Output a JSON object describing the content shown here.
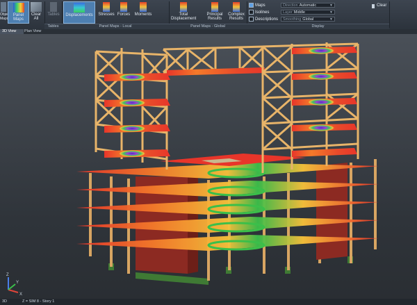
{
  "ribbon": {
    "buttons": {
      "object_maps": "Object\nMaps",
      "panel_maps": "Panel Maps",
      "clear_all": "Clear All",
      "tables_small": "Tables",
      "tables": "Tables",
      "displacements": "Displacements",
      "stresses": "Stresses",
      "forces": "Forces",
      "moments": "Moments",
      "total_displacement": "Total\nDisplacement",
      "principal_results": "Principal\nResults",
      "complex_results": "Complex\nResults",
      "clear": "Clear"
    },
    "groups": {
      "panel_maps_local": "Panel Maps - Local",
      "panel_maps_global": "Panel Maps - Global",
      "display": "Display"
    },
    "display": {
      "maps": "Maps",
      "isolines": "Isolines",
      "descriptions": "Descriptions",
      "direction_label": "Direction",
      "direction_value": "Automatic",
      "layer_label": "Layer",
      "layer_value": "Middle",
      "smoothing_label": "Smoothing",
      "smoothing_value": "Global",
      "maps_checked": true,
      "isolines_checked": false,
      "descriptions_checked": false
    }
  },
  "view_tabs": [
    "3D View",
    "Plan View"
  ],
  "viewport": {
    "axis_z": "Z",
    "axis_x": "X",
    "axis_y": "Y"
  },
  "status": {
    "view_mode": "3D",
    "story": "Z = SIM 8 - Story 1"
  },
  "colors": {
    "frame": "#e8b469",
    "slab_hot": "#e8352a",
    "slab_mid": "#f9c23a",
    "slab_cool": "#3bbf4a",
    "wall": "#8c2a22",
    "foundation": "#3f7a34"
  }
}
